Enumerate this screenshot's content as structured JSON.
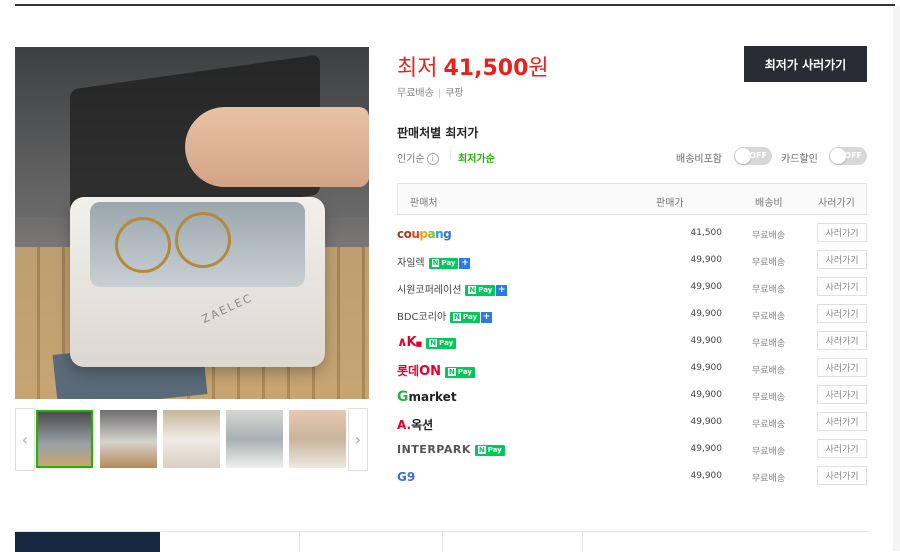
{
  "price": {
    "label": "최저",
    "amount": "41,500",
    "unit": "원"
  },
  "shipping_info": {
    "shipping": "무료배송",
    "mall": "쿠팡"
  },
  "buy_button": "최저가 사러가기",
  "section_title": "판매처별 최저가",
  "sort": {
    "popular": "인기순",
    "lowest": "최저가순"
  },
  "toggles": [
    {
      "label": "배송비포함",
      "state": "OFF"
    },
    {
      "label": "카드할인",
      "state": "OFF"
    }
  ],
  "table": {
    "headers": [
      "판매처",
      "판매가",
      "배송비",
      "사러가기"
    ],
    "rows": [
      {
        "seller": "coupang",
        "price": "41,500",
        "shipping": "무료배송",
        "action": "사러가기"
      },
      {
        "seller": "자일렉",
        "price": "49,900",
        "shipping": "무료배송",
        "action": "사러가기"
      },
      {
        "seller": "시원코퍼레이션",
        "price": "49,900",
        "shipping": "무료배송",
        "action": "사러가기"
      },
      {
        "seller": "BDC코리아",
        "price": "49,900",
        "shipping": "무료배송",
        "action": "사러가기"
      },
      {
        "seller": "AK",
        "price": "49,900",
        "shipping": "무료배송",
        "action": "사러가기"
      },
      {
        "seller": "롯데ON",
        "price": "49,900",
        "shipping": "무료배송",
        "action": "사러가기"
      },
      {
        "seller": "Gmarket",
        "price": "49,900",
        "shipping": "무료배송",
        "action": "사러가기"
      },
      {
        "seller": "A.옥션",
        "price": "49,900",
        "shipping": "무료배송",
        "action": "사러가기"
      },
      {
        "seller": "INTERPARK",
        "price": "49,900",
        "shipping": "무료배송",
        "action": "사러가기"
      },
      {
        "seller": "G9",
        "price": "49,900",
        "shipping": "무료배송",
        "action": "사러가기"
      }
    ]
  },
  "npay": {
    "n": "N",
    "pay": "Pay",
    "plus": "+"
  },
  "image_brand": "ZAELEC",
  "thumb_arrows": {
    "prev": "‹",
    "next": "›"
  },
  "info_icon": "i",
  "colors": {
    "accent_green": "#1fb400",
    "price_red": "#e8221b",
    "dark_button": "#2a2c33",
    "tab_active": "#172840"
  }
}
